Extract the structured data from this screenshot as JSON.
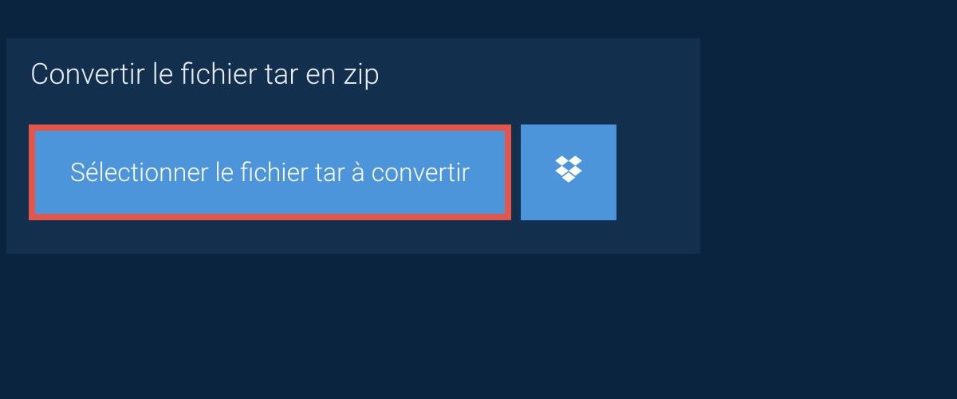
{
  "title": "Convertir le fichier tar en zip",
  "buttons": {
    "select_label": "Sélectionner le fichier tar à convertir"
  },
  "colors": {
    "page_bg": "#0a2440",
    "panel_bg": "#12304e",
    "accent": "#4c95da",
    "highlight_border": "#e2564c",
    "text": "#ffffff"
  },
  "icons": {
    "dropbox": "dropbox-icon"
  }
}
